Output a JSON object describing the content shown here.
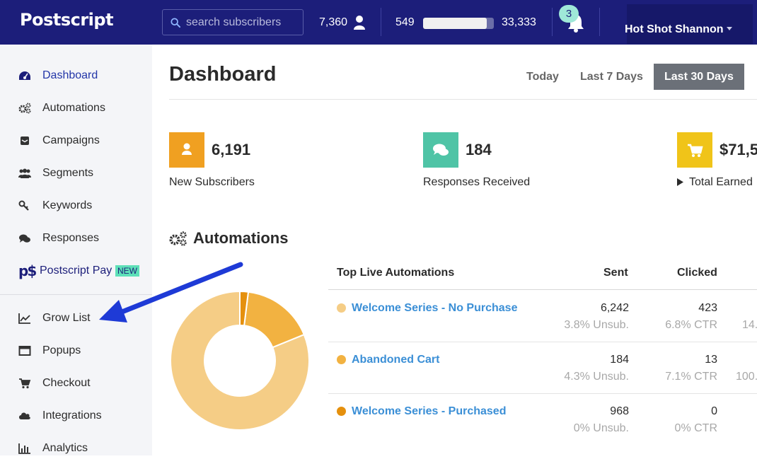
{
  "header": {
    "logo": "Postscript",
    "search_placeholder": "search subscribers",
    "subscriber_count": "7,360",
    "credits_used": "549",
    "credits_total": "33,333",
    "credits_progress": 0.9,
    "notification_count": "3",
    "user_name": "Hot Shot Shannon"
  },
  "sidebar": {
    "items": [
      {
        "label": "Dashboard",
        "icon": "dashboard-gauge-icon"
      },
      {
        "label": "Automations",
        "icon": "gears-icon"
      },
      {
        "label": "Campaigns",
        "icon": "envelope-icon"
      },
      {
        "label": "Segments",
        "icon": "users-icon"
      },
      {
        "label": "Keywords",
        "icon": "key-icon"
      },
      {
        "label": "Responses",
        "icon": "chat-bubbles-icon"
      },
      {
        "label": "Postscript Pay",
        "icon": "postscript-pay-logo",
        "badge": "NEW"
      },
      {
        "label": "Grow List",
        "icon": "line-chart-icon"
      },
      {
        "label": "Popups",
        "icon": "window-icon"
      },
      {
        "label": "Checkout",
        "icon": "cart-icon"
      },
      {
        "label": "Integrations",
        "icon": "cloud-icon"
      },
      {
        "label": "Analytics",
        "icon": "bar-chart-icon"
      }
    ],
    "pay_logo_text": "p$"
  },
  "main": {
    "title": "Dashboard",
    "ranges": [
      {
        "label": "Today"
      },
      {
        "label": "Last 7 Days"
      },
      {
        "label": "Last 30 Days",
        "active": true
      }
    ],
    "kpis": [
      {
        "value": "6,191",
        "label": "New Subscribers",
        "color": "#f0a021",
        "icon": "user-icon"
      },
      {
        "value": "184",
        "label": "Responses Received",
        "color": "#4fc4a6",
        "icon": "chat-icon"
      },
      {
        "value": "$71,5",
        "label": "Total Earned",
        "color": "#f0c419",
        "icon": "cart-icon"
      }
    ],
    "automations": {
      "title": "Automations",
      "table": {
        "headers": [
          "Top Live Automations",
          "Sent",
          "Clicked"
        ],
        "rows": [
          {
            "name": "Welcome Series - No Purchase",
            "sent": "6,242",
            "unsub": "3.8% Unsub.",
            "clicked": "423",
            "ctr": "6.8% CTR",
            "extra": "14.",
            "color": "#f5cd86"
          },
          {
            "name": "Abandoned Cart",
            "sent": "184",
            "unsub": "4.3% Unsub.",
            "clicked": "13",
            "ctr": "7.1% CTR",
            "extra": "100.",
            "color": "#f2b241"
          },
          {
            "name": "Welcome Series - Purchased",
            "sent": "968",
            "unsub": "0% Unsub.",
            "clicked": "0",
            "ctr": "0% CTR",
            "extra": "",
            "color": "#e5900d"
          }
        ]
      },
      "chart_data": {
        "type": "pie",
        "categories": [
          "Welcome Series - No Purchase",
          "Abandoned Cart",
          "Welcome Series - Purchased"
        ],
        "values": [
          6242,
          1300,
          150
        ],
        "colors": [
          "#f5cd86",
          "#f2b241",
          "#e5900d"
        ]
      }
    }
  }
}
